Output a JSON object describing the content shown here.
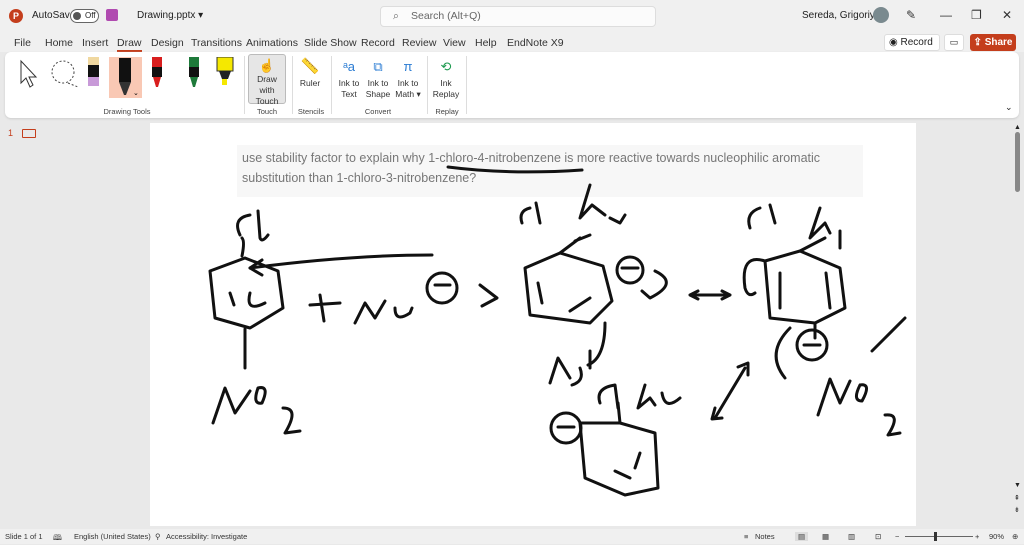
{
  "titlebar": {
    "autosave": "AutoSave",
    "toggle": "Off",
    "filename": "Drawing.pptx ▾",
    "search_placeholder": "Search (Alt+Q)",
    "user": "Sereda, Grigoriy A"
  },
  "menu": {
    "tabs": [
      "File",
      "Home",
      "Insert",
      "Draw",
      "Design",
      "Transitions",
      "Animations",
      "Slide Show",
      "Record",
      "Review",
      "View",
      "Help",
      "EndNote X9"
    ],
    "record": "Record",
    "share": "Share"
  },
  "ribbon": {
    "drawing_tools": "Drawing Tools",
    "draw_with_touch": [
      "Draw with",
      "Touch"
    ],
    "touch": "Touch",
    "ruler": "Ruler",
    "stencils": "Stencils",
    "ink_to_text": [
      "Ink to",
      "Text"
    ],
    "ink_to_shape": [
      "Ink to",
      "Shape"
    ],
    "ink_to_math": [
      "Ink to",
      "Math ▾"
    ],
    "convert": "Convert",
    "ink_replay": [
      "Ink",
      "Replay"
    ],
    "replay": "Replay"
  },
  "thumb": {
    "number": "1"
  },
  "slide": {
    "question": "use stability factor to explain why 1-chloro-4-nitrobenzene is more reactive towards nucleophilic aromatic substitution than 1-chloro-3-nitrobenzene?"
  },
  "status": {
    "slide": "Slide 1 of 1",
    "language": "English (United States)",
    "accessibility": "Accessibility: Investigate",
    "notes": "Notes",
    "zoom": "90%"
  },
  "colors": {
    "accent": "#c43e1c",
    "pen_red": "#d81e1e",
    "pen_green": "#1e7a3a",
    "highlighter": "#f5e800"
  }
}
